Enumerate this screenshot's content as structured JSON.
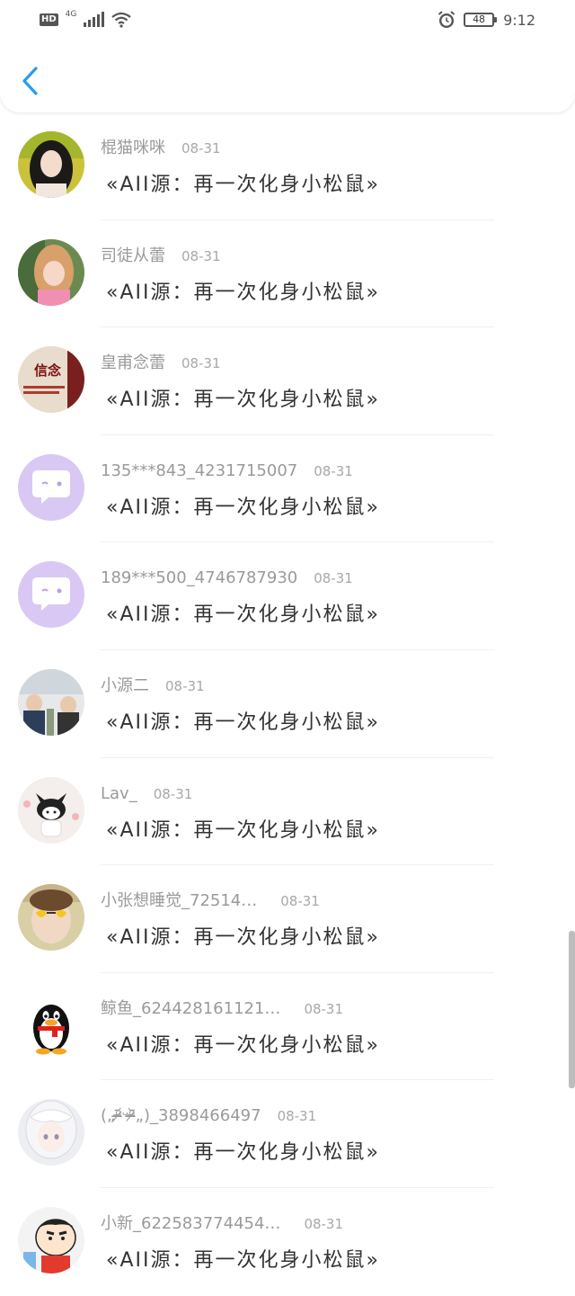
{
  "status_bar": {
    "hd": "HD",
    "network": "4G",
    "battery": "48",
    "time": "9:12"
  },
  "items": [
    {
      "name": "棍猫咪咪",
      "date": "08-31",
      "message": "«AII源：再一次化身小松鼠»",
      "avatar": "photo-girl-avatar"
    },
    {
      "name": "司徒从蕾",
      "date": "08-31",
      "message": "«AII源：再一次化身小松鼠»",
      "avatar": "photo-girl-pink-avatar"
    },
    {
      "name": "皇甫念蕾",
      "date": "08-31",
      "message": "«AII源：再一次化身小松鼠»",
      "avatar": "xinnian-text-avatar",
      "avatar_text": "信念"
    },
    {
      "name": "135***843_4231715007",
      "date": "08-31",
      "message": "«AII源：再一次化身小松鼠»",
      "avatar": "default-chat-bubble-avatar"
    },
    {
      "name": "189***500_4746787930",
      "date": "08-31",
      "message": "«AII源：再一次化身小松鼠»",
      "avatar": "default-chat-bubble-avatar"
    },
    {
      "name": "小源二",
      "date": "08-31",
      "message": "«AII源：再一次化身小松鼠»",
      "avatar": "photo-people-avatar"
    },
    {
      "name": "Lav_",
      "date": "08-31",
      "message": "«AII源：再一次化身小松鼠»",
      "avatar": "kuromi-avatar"
    },
    {
      "name": "小张想睡觉_72514…",
      "date": "08-31",
      "message": "«AII源：再一次化身小松鼠»",
      "avatar": "photo-sunglasses-avatar"
    },
    {
      "name": "鲸鱼_624428161121…",
      "date": "08-31",
      "message": "«AII源：再一次化身小松鼠»",
      "avatar": "qq-penguin-avatar"
    },
    {
      "name": "(„ᵒ̴̶̷᷄ᵕᵒ̴̶̷᷅„)_3898466497",
      "date": "08-31",
      "message": "«AII源：再一次化身小松鼠»",
      "avatar": "anime-white-hair-avatar"
    },
    {
      "name": "小新_622583774454…",
      "date": "08-31",
      "message": "«AII源：再一次化身小松鼠»",
      "avatar": "shinchan-avatar"
    }
  ],
  "colors": {
    "accent": "#2a9bf0",
    "name_text": "#9a9a9a",
    "message_text": "#333333",
    "default_avatar_bg": "#d9c8f4"
  }
}
